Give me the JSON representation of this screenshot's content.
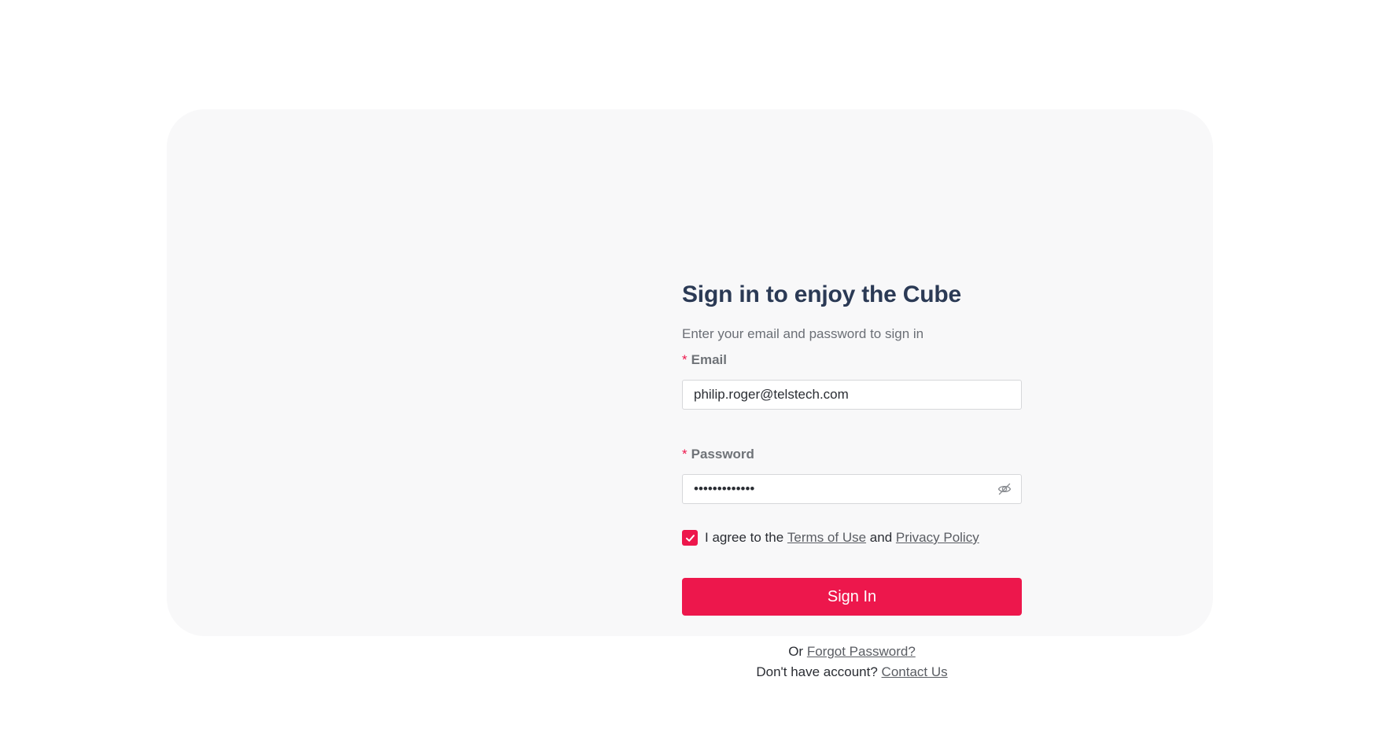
{
  "form": {
    "title": "Sign in to enjoy the Cube",
    "subtitle": "Enter your email and password to sign in"
  },
  "email": {
    "required_mark": "*",
    "label": "Email",
    "value": "philip.roger@telstech.com"
  },
  "password": {
    "required_mark": "*",
    "label": "Password",
    "value": "•••••••••••••",
    "toggle_icon": "eye-off-icon"
  },
  "agreement": {
    "checked": true,
    "prefix": "I agree to the",
    "terms_link": "Terms of Use",
    "conjunction": "and",
    "privacy_link": "Privacy Policy"
  },
  "signin_button": "Sign In",
  "forgot": {
    "prefix": "Or",
    "link": "Forgot Password?"
  },
  "signup": {
    "prefix": "Don't have account?",
    "link": "Contact Us"
  },
  "colors": {
    "accent": "#ED174C",
    "title": "#2B3A55",
    "card_background": "#F8F8F9"
  }
}
